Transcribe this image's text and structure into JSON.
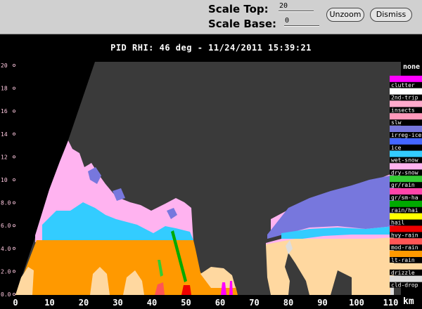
{
  "toolbar": {
    "scale_top_label": "Scale Top:",
    "scale_top_value": "20",
    "scale_base_label": "Scale Base:",
    "scale_base_value": "0",
    "unzoom_label": "Unzoom",
    "dismiss_label": "Dismiss"
  },
  "plot": {
    "title": "PID  RHI: 46 deg  -  11/24/2011 15:39:21",
    "xunit": "km",
    "background_color": "#3a3a3a",
    "xticks": [
      "0",
      "10",
      "20",
      "30",
      "40",
      "50",
      "60",
      "70",
      "80",
      "90",
      "100",
      "110"
    ],
    "yticks": [
      "0.0",
      "2.0",
      "4.0",
      "6.0",
      "8.0",
      "10",
      "12",
      "14",
      "16",
      "18",
      "20"
    ]
  },
  "legend": {
    "items": [
      {
        "label": "none",
        "color": "#000000"
      },
      {
        "label": "clutter",
        "color": "#ff00ff"
      },
      {
        "label": "2nd-trip",
        "color": "#ffffff"
      },
      {
        "label": "insects",
        "color": "#ffaacc"
      },
      {
        "label": "slw",
        "color": "#ff99bb"
      },
      {
        "label": "irreg-ice",
        "color": "#7777dd"
      },
      {
        "label": "ice",
        "color": "#4466ff"
      },
      {
        "label": "wet-snow",
        "color": "#33ccff"
      },
      {
        "label": "dry-snow",
        "color": "#ffb3f0"
      },
      {
        "label": "gr/rain",
        "color": "#33cc33"
      },
      {
        "label": "gr/sm-ha",
        "color": "#ff44aa"
      },
      {
        "label": "rain/hai",
        "color": "#00aa00"
      },
      {
        "label": "hail",
        "color": "#ffff00"
      },
      {
        "label": "hvy-rain",
        "color": "#ee0000"
      },
      {
        "label": "mod-rain",
        "color": "#ff5555"
      },
      {
        "label": "lt-rain",
        "color": "#ff9900"
      },
      {
        "label": "drizzle",
        "color": "#ffd8a0"
      },
      {
        "label": "cld-drop",
        "color": "#dddddd"
      }
    ]
  }
}
